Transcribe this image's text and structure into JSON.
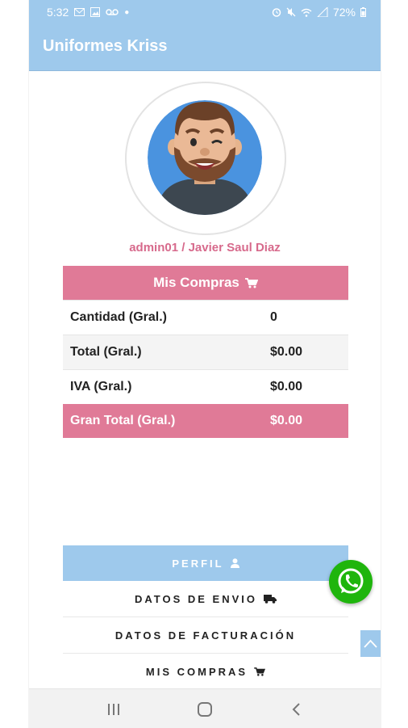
{
  "status_bar": {
    "time": "5:32",
    "battery": "72%"
  },
  "app": {
    "title": "Uniformes Kriss"
  },
  "profile": {
    "user_label": "admin01 / Javier Saul Diaz"
  },
  "summary": {
    "title": "Mis Compras",
    "rows": [
      {
        "label": "Cantidad (Gral.)",
        "value": "0"
      },
      {
        "label": "Total (Gral.)",
        "value": "$0.00"
      },
      {
        "label": "IVA (Gral.)",
        "value": "$0.00"
      },
      {
        "label": "Gran Total (Gral.)",
        "value": "$0.00"
      }
    ]
  },
  "menu": {
    "items": [
      {
        "label": "PERFIL",
        "icon": "user-icon"
      },
      {
        "label": "DATOS DE ENVIO",
        "icon": "truck-icon"
      },
      {
        "label": "DATOS DE FACTURACIÓN",
        "icon": ""
      },
      {
        "label": "MIS COMPRAS",
        "icon": "cart-icon"
      }
    ]
  },
  "colors": {
    "primary": "#9ec9ec",
    "accent": "#e07a97",
    "whatsapp": "#1fb50d"
  }
}
